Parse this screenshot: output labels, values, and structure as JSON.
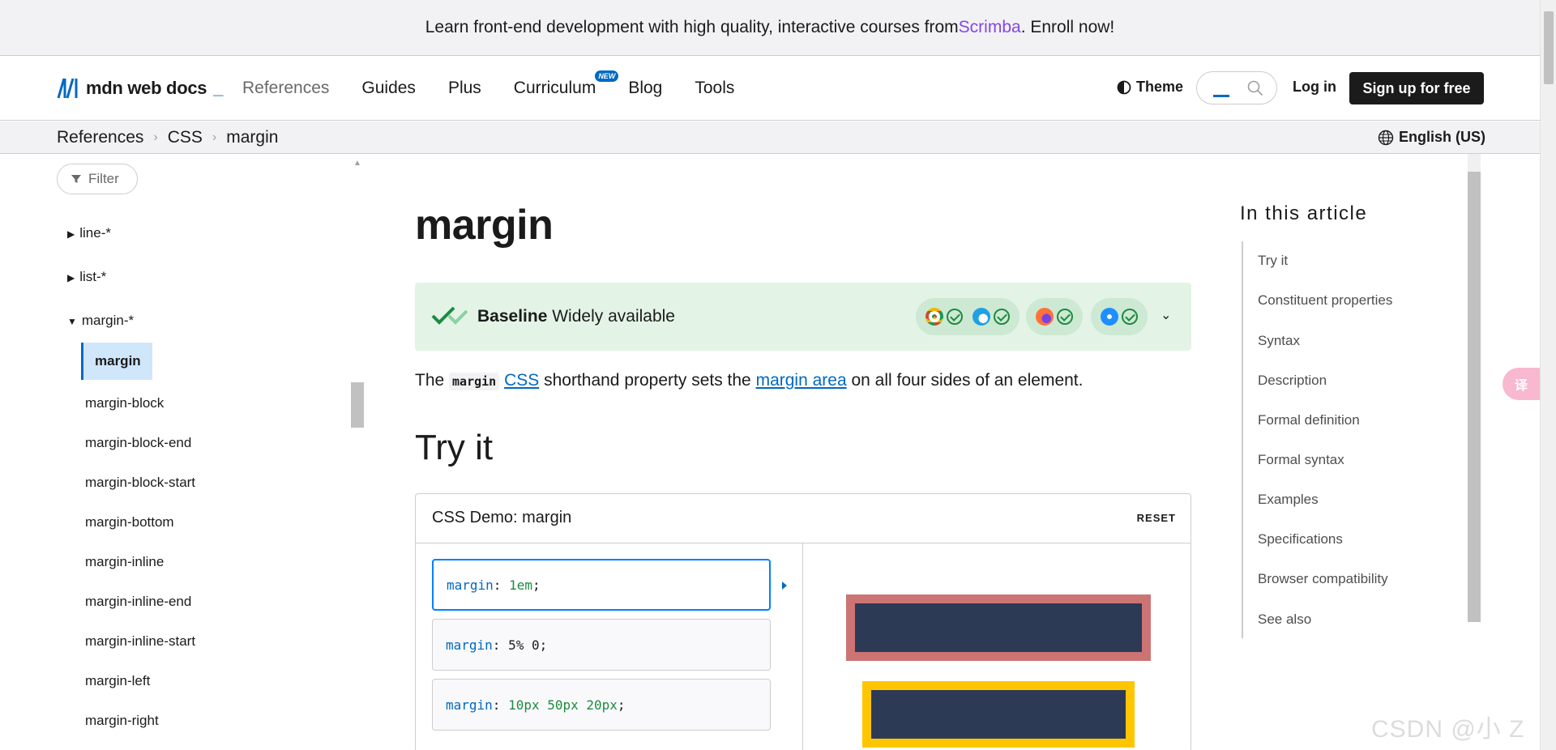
{
  "banner": {
    "text_before": "Learn front-end development with high quality, interactive courses from ",
    "link": "Scrimba",
    "text_after": ". Enroll now!"
  },
  "header": {
    "logo_text": "mdn web docs",
    "logo_underscore": "_",
    "nav": [
      {
        "label": "References"
      },
      {
        "label": "Guides"
      },
      {
        "label": "Plus"
      },
      {
        "label": "Curriculum",
        "badge": "NEW"
      },
      {
        "label": "Blog"
      },
      {
        "label": "Tools"
      }
    ],
    "theme_label": "Theme",
    "login_label": "Log in",
    "signup_label": "Sign up for free"
  },
  "breadcrumb": {
    "items": [
      "References",
      "CSS",
      "margin"
    ],
    "separator": "›",
    "language": "English (US)"
  },
  "sidebar": {
    "filter_label": "Filter",
    "groups": [
      {
        "label": "line-*",
        "expanded": false
      },
      {
        "label": "list-*",
        "expanded": false
      },
      {
        "label": "margin-*",
        "expanded": true
      }
    ],
    "active_item": "margin",
    "items": [
      "margin-block",
      "margin-block-end",
      "margin-block-start",
      "margin-bottom",
      "margin-inline",
      "margin-inline-end",
      "margin-inline-start",
      "margin-left",
      "margin-right"
    ]
  },
  "main": {
    "title": "margin",
    "baseline": {
      "bold": "Baseline",
      "status": "Widely available"
    },
    "lead": {
      "t1": "The ",
      "code": "margin",
      "t2": " ",
      "link1": "CSS",
      "t3": " shorthand property sets the ",
      "link2": "margin area",
      "t4": " on all four sides of an element."
    },
    "try_heading": "Try it",
    "demo": {
      "title": "CSS Demo: margin",
      "reset": "RESET",
      "choices": [
        {
          "prop": "margin",
          "value": "1em"
        },
        {
          "prop": "margin",
          "value": "5% 0"
        },
        {
          "prop": "margin",
          "value": "10px 50px 20px"
        }
      ]
    }
  },
  "toc": {
    "title": "In this article",
    "items": [
      "Try it",
      "Constituent properties",
      "Syntax",
      "Description",
      "Formal definition",
      "Formal syntax",
      "Examples",
      "Specifications",
      "Browser compatibility",
      "See also"
    ]
  },
  "floating": {
    "translate_glyph": "译"
  },
  "watermark": "CSDN @小 Z",
  "colors": {
    "accent": "#0069c2",
    "scrimba": "#8447e9",
    "baseline_bg": "#e3f4e7",
    "demo_red": "#cc7474",
    "demo_yellow": "#ffc600",
    "demo_navy": "#2d3a56"
  }
}
